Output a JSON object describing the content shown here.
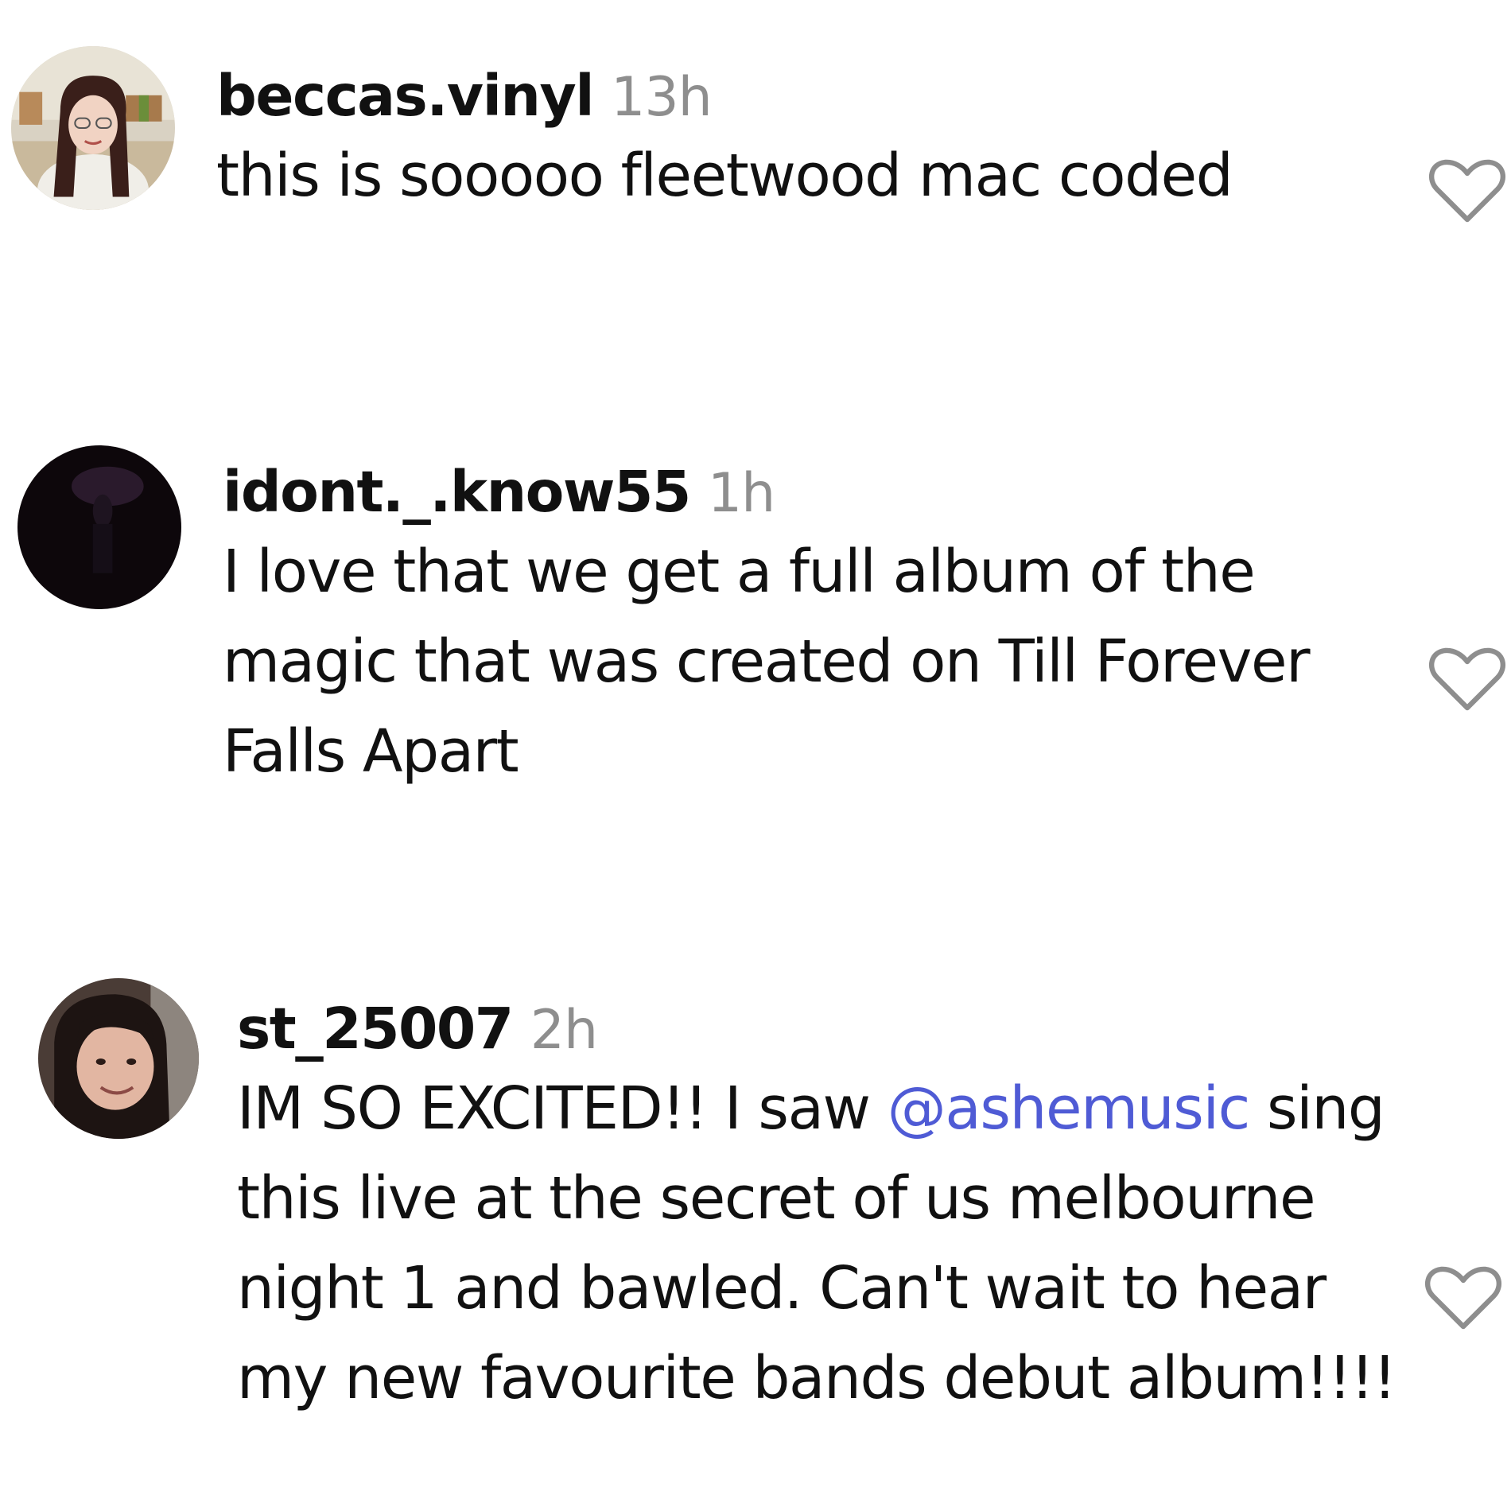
{
  "comments": [
    {
      "username": "beccas.vinyl",
      "time": "13h",
      "text": "this is sooooo fleetwood mac coded",
      "liked": false
    },
    {
      "username": "idont._.know55",
      "time": "1h",
      "text": "I love that we get a full album of the magic that was created on Till Forever Falls Apart",
      "liked": false
    },
    {
      "username": "st_25007",
      "time": "2h",
      "text_before": "IM SO EXCITED!! I saw ",
      "mention": "@ashemusic",
      "text_after": " sing this live at the secret of us melbourne night 1 and bawled. Can't wait to hear my new favourite bands debut album!!!!",
      "liked": false
    }
  ],
  "colors": {
    "text": "#111111",
    "timestamp": "#8e8e8e",
    "mention": "#4f5bd5",
    "heart_outline": "#8e8e8e"
  },
  "icons": {
    "like": "heart-outline-icon"
  }
}
